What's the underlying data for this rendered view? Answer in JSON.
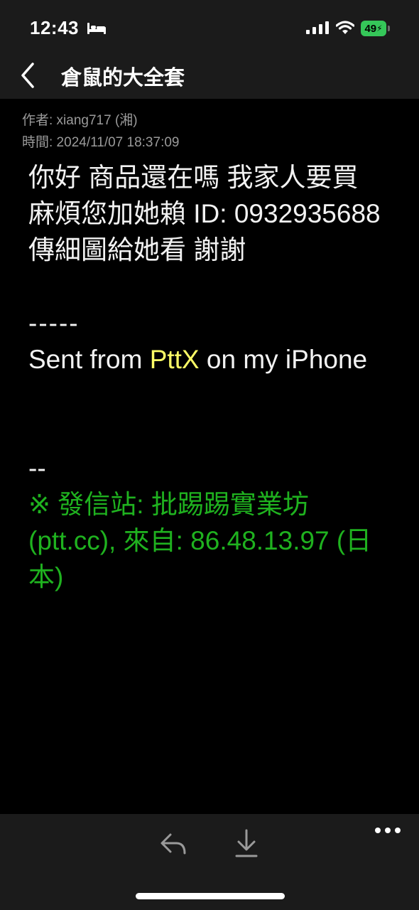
{
  "status_bar": {
    "time": "12:43",
    "battery": "49",
    "sleep_icon": "bed-icon",
    "signal_icon": "signal-icon",
    "wifi_icon": "wifi-icon",
    "battery_color": "#35c759"
  },
  "nav": {
    "back_icon": "chevron-left-icon",
    "title": "倉鼠的大全套"
  },
  "post": {
    "author": "作者: xiang717 (湘)",
    "time": "時間: 2024/11/07 18:37:09",
    "body": "你好 商品還在嗎 我家人要買 麻煩您加她賴 ID: 0932935688 傳細圖給她看 謝謝",
    "separator": "-----",
    "sent_prefix": "Sent from ",
    "sent_app": "PttX",
    "sent_suffix": " on my iPhone",
    "signature_separator": "--",
    "origin": "※ 發信站: 批踢踢實業坊 (ptt.cc), 來自: 86.48.13.97 (日本)",
    "colors": {
      "app_highlight": "#ffff66",
      "origin": "#1fb21f",
      "meta": "#9a9a9a"
    }
  },
  "toolbar": {
    "reply_icon": "reply-icon",
    "download_icon": "download-arrow-icon",
    "more_icon": "more-dots-icon"
  }
}
